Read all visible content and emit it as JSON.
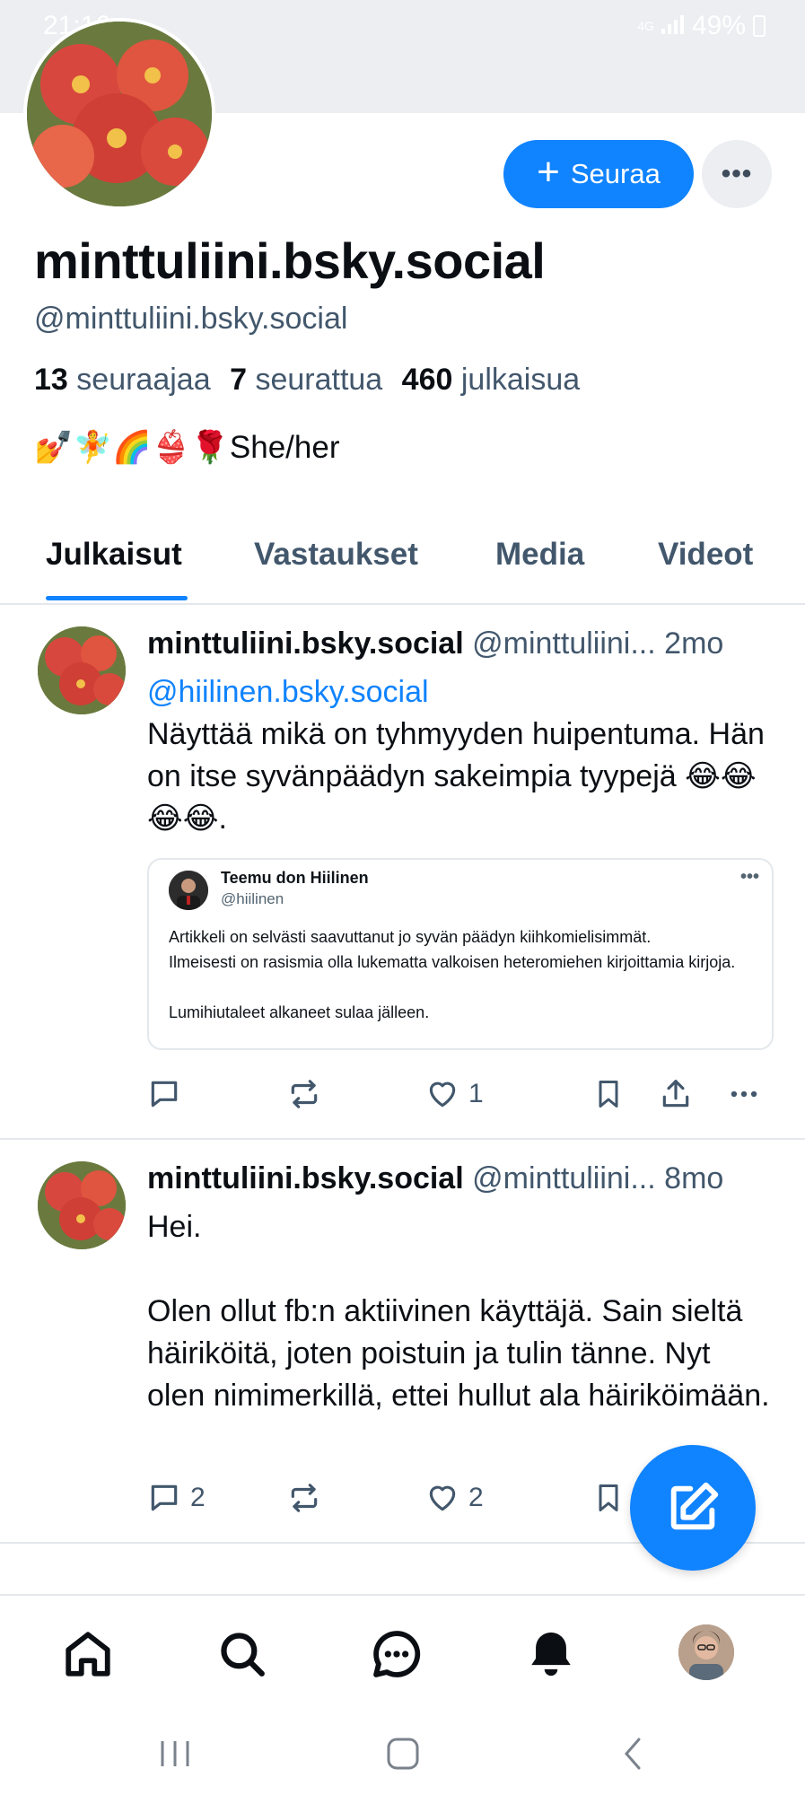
{
  "status_bar": {
    "time": "21:16",
    "network": "4G",
    "battery": "49%"
  },
  "profile": {
    "display_name": "minttuliini.bsky.social",
    "handle": "@minttuliini.bsky.social",
    "followers_count": "13",
    "followers_label": "seuraajaa",
    "following_count": "7",
    "following_label": "seurattua",
    "posts_count": "460",
    "posts_label": "julkaisua",
    "bio": "💅🧚🌈👙🌹She/her",
    "follow_label": "Seuraa",
    "more_label": "•••"
  },
  "tabs": [
    {
      "label": "Julkaisut",
      "active": true
    },
    {
      "label": "Vastaukset",
      "active": false
    },
    {
      "label": "Media",
      "active": false
    },
    {
      "label": "Videot",
      "active": false
    }
  ],
  "posts": [
    {
      "author_name": "minttuliini.bsky.social",
      "author_handle": "@minttuliini...",
      "age": "2mo",
      "mention": "@hiilinen.bsky.social",
      "text": "Näyttää mikä on tyhmyyden huipentuma. Hän on itse syvänpäädyn sakeimpia tyypejä 😂😂😂😂.",
      "embed": {
        "name": "Teemu don Hiilinen",
        "handle": "@hiilinen",
        "line1": "Artikkeli on selvästi saavuttanut jo syvän päädyn kiihkomielisimmät.",
        "line2": "Ilmeisesti on rasismia olla lukematta valkoisen heteromiehen kirjoittamia kirjoja.",
        "line3": "Lumihiutaleet alkaneet sulaa jälleen.",
        "dots": "•••"
      },
      "reply_count": "",
      "repost_count": "",
      "like_count": "1"
    },
    {
      "author_name": "minttuliini.bsky.social",
      "author_handle": "@minttuliini...",
      "age": "8mo",
      "text_line1": "Hei.",
      "text_line2": "Olen ollut fb:n aktiivinen käyttäjä. Sain sieltä häiriköitä, joten poistuin ja tulin tänne. Nyt olen nimimerkillä, ettei hullut ala häiriköimään.",
      "reply_count": "2",
      "repost_count": "",
      "like_count": "2"
    }
  ],
  "colors": {
    "accent": "#1083fe",
    "muted_text": "#42576c",
    "divider": "#e4e8ec"
  }
}
